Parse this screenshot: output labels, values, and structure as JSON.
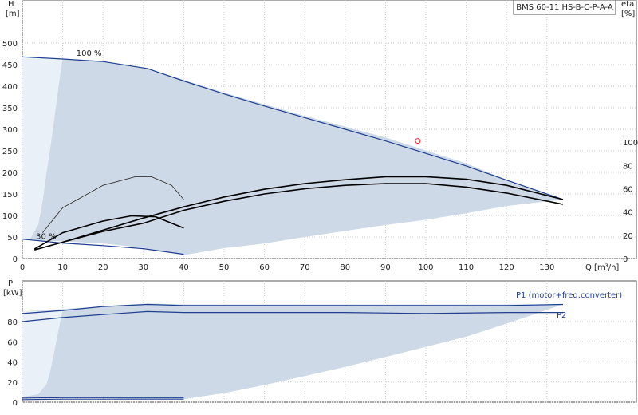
{
  "chart_data": [
    {
      "type": "line",
      "title": "BMS 60-11 HS-B-C-P-A-A",
      "ylabel": "H",
      "ylabel_unit": "[m]",
      "ylabel_right": "eta",
      "ylabel_right_unit": "[%]",
      "xlabel": "Q [m³/h]",
      "xlim": [
        0,
        150
      ],
      "ylim": [
        0,
        500
      ],
      "xticks": [
        0,
        10,
        20,
        30,
        40,
        50,
        60,
        70,
        80,
        90,
        100,
        110,
        120,
        130
      ],
      "yticks": [
        0,
        50,
        100,
        150,
        200,
        250,
        300,
        350,
        400,
        450,
        500
      ],
      "yticks_right": [
        0,
        20,
        40,
        60,
        80,
        100
      ],
      "yright_scale": 2.7,
      "grid": true,
      "annotations": [
        {
          "text": "100 %",
          "x": 13,
          "y": 470
        },
        {
          "text": "30 %",
          "x": 3,
          "y": 45
        }
      ],
      "duty_point": {
        "x": 98,
        "y": 273
      },
      "regions": {
        "operating_area": [
          [
            0,
            468
          ],
          [
            20,
            457
          ],
          [
            31,
            441
          ],
          [
            50,
            385
          ],
          [
            70,
            331
          ],
          [
            90,
            281
          ],
          [
            100,
            251
          ],
          [
            110,
            221
          ],
          [
            120,
            183
          ],
          [
            134,
            137
          ],
          [
            120,
            122
          ],
          [
            110,
            105
          ],
          [
            100,
            90
          ],
          [
            90,
            78
          ],
          [
            80,
            64
          ],
          [
            70,
            50
          ],
          [
            60,
            35
          ],
          [
            50,
            24
          ],
          [
            40,
            8
          ],
          [
            30,
            25
          ],
          [
            20,
            35
          ],
          [
            10,
            40
          ],
          [
            0,
            43
          ]
        ],
        "light_area": [
          [
            0,
            468
          ],
          [
            10,
            465
          ],
          [
            9,
            400
          ],
          [
            8,
            330
          ],
          [
            7,
            260
          ],
          [
            6,
            200
          ],
          [
            5,
            130
          ],
          [
            4,
            80
          ],
          [
            2,
            46
          ],
          [
            0,
            43
          ]
        ]
      },
      "series": [
        {
          "name": "100 %",
          "role": "head",
          "color": "#1f3f8f",
          "x": [
            0,
            10,
            20,
            31,
            40,
            50,
            60,
            70,
            80,
            90,
            100,
            110,
            120,
            134
          ],
          "y": [
            468,
            463,
            457,
            441,
            412,
            382,
            354,
            327,
            300,
            273,
            244,
            215,
            182,
            137
          ]
        },
        {
          "name": "30 %",
          "role": "head",
          "color": "#1f3f8f",
          "x": [
            0,
            10,
            20,
            30,
            40
          ],
          "y": [
            45,
            36,
            30,
            23,
            10
          ]
        },
        {
          "name": "",
          "role": "efficiency",
          "color": "#000000",
          "x": [
            3,
            10,
            20,
            30,
            40,
            50,
            60,
            70,
            80,
            90,
            100,
            110,
            120,
            134
          ],
          "y": [
            20,
            38,
            63,
            82,
            112,
            133,
            150,
            162,
            170,
            174,
            174,
            166,
            152,
            126
          ]
        },
        {
          "name": "",
          "role": "efficiency",
          "color": "#000000",
          "x": [
            10,
            20,
            30,
            40,
            50,
            60,
            70,
            80,
            90,
            100,
            110,
            120,
            134
          ],
          "y": [
            38,
            66,
            94,
            120,
            143,
            161,
            174,
            183,
            190,
            190,
            184,
            170,
            137
          ]
        },
        {
          "name": "",
          "role": "efficiency",
          "color": "#000000",
          "x": [
            3,
            10,
            20,
            27,
            33,
            40
          ],
          "y": [
            22,
            60,
            87,
            99,
            97,
            71
          ]
        },
        {
          "name": "",
          "role": "efficiency",
          "color": "#333333",
          "x": [
            5,
            10,
            20,
            28,
            32,
            37,
            40
          ],
          "y": [
            60,
            118,
            170,
            190,
            190,
            170,
            137
          ]
        }
      ]
    },
    {
      "type": "line",
      "ylabel": "P",
      "ylabel_unit": "[kW]",
      "xlim": [
        0,
        150
      ],
      "ylim": [
        0,
        100
      ],
      "yticks": [
        0,
        20,
        40,
        60,
        80
      ],
      "grid": true,
      "regions": {
        "operating_area": [
          [
            0,
            90
          ],
          [
            20,
            95
          ],
          [
            31,
            98
          ],
          [
            40,
            97
          ],
          [
            60,
            97
          ],
          [
            80,
            97
          ],
          [
            100,
            97
          ],
          [
            120,
            97
          ],
          [
            134,
            97
          ],
          [
            120,
            78
          ],
          [
            110,
            65
          ],
          [
            100,
            55
          ],
          [
            90,
            45
          ],
          [
            80,
            35
          ],
          [
            70,
            26
          ],
          [
            60,
            17
          ],
          [
            50,
            9
          ],
          [
            40,
            3
          ],
          [
            30,
            3
          ],
          [
            20,
            4
          ],
          [
            10,
            5
          ],
          [
            0,
            5
          ]
        ],
        "light_area": [
          [
            0,
            90
          ],
          [
            10,
            91
          ],
          [
            9,
            72
          ],
          [
            8,
            52
          ],
          [
            7,
            32
          ],
          [
            6,
            18
          ],
          [
            4,
            8
          ],
          [
            0,
            5
          ]
        ]
      },
      "series": [
        {
          "name": "P1 (motor+freq.converter)",
          "color": "#1f3f8f",
          "x": [
            0,
            10,
            20,
            31,
            40,
            60,
            80,
            100,
            120,
            134
          ],
          "y": [
            88,
            91,
            95,
            97,
            96,
            96,
            96,
            96,
            96,
            97
          ]
        },
        {
          "name": "P2",
          "color": "#1f3f8f",
          "x": [
            0,
            10,
            20,
            31,
            40,
            60,
            80,
            100,
            120,
            134
          ],
          "y": [
            80,
            84,
            87,
            90,
            89,
            89,
            89,
            88,
            89,
            89
          ]
        },
        {
          "name": "",
          "color": "#1f3f8f",
          "x": [
            0,
            10,
            20,
            30,
            40
          ],
          "y": [
            4,
            4.5,
            4.5,
            4.5,
            4.5
          ]
        },
        {
          "name": "",
          "color": "#1f3f8f",
          "x": [
            0,
            10,
            20,
            30,
            40
          ],
          "y": [
            2.5,
            3,
            3,
            3,
            3
          ]
        }
      ]
    }
  ]
}
